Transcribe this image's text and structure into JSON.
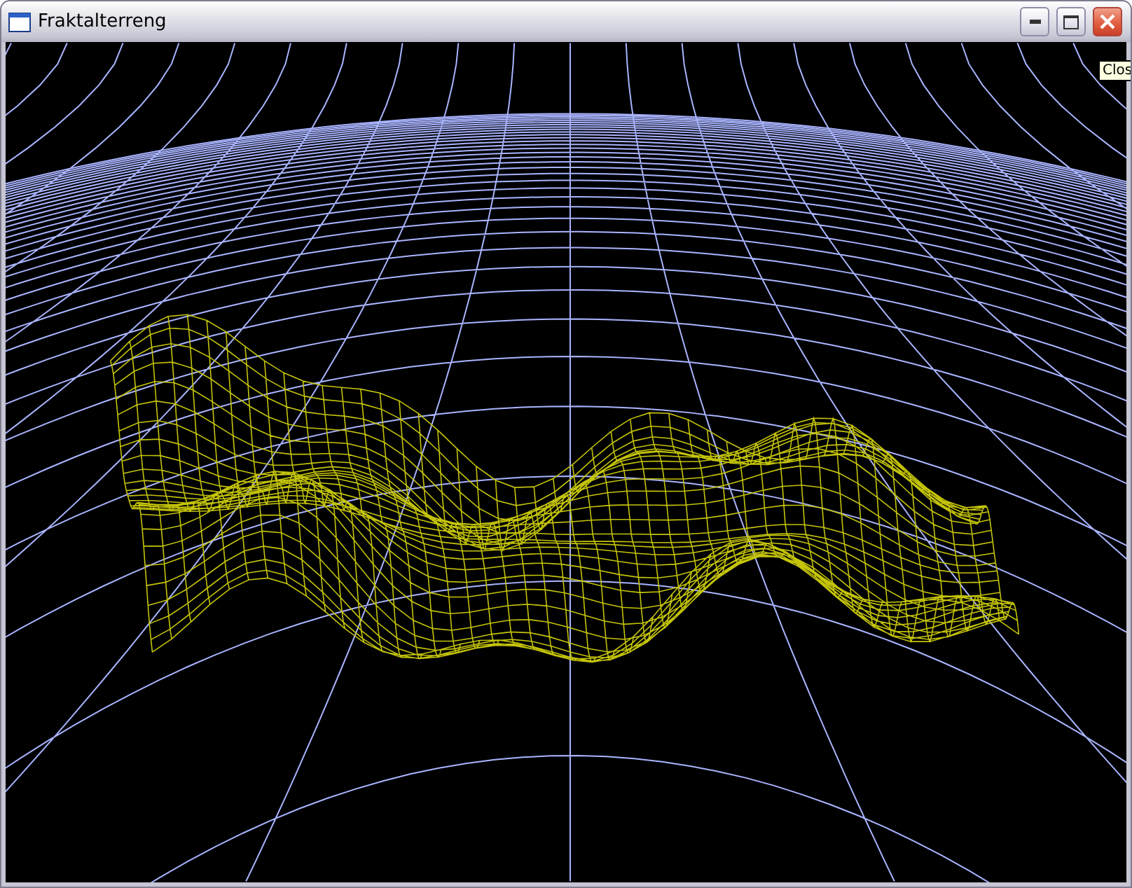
{
  "window": {
    "title": "Fraktalterreng"
  },
  "tooltip": {
    "text": "Clos"
  }
}
